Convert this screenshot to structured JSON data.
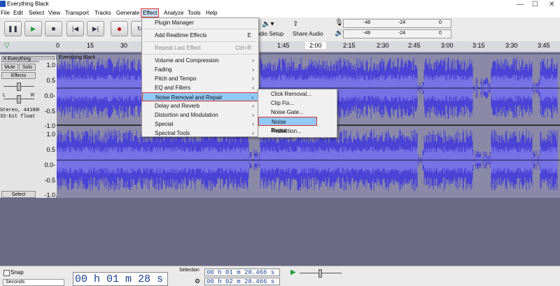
{
  "window": {
    "title": "Everything Black",
    "min": "—",
    "max": "☐",
    "close": "✕"
  },
  "menubar": [
    {
      "label": "File"
    },
    {
      "label": "Edit"
    },
    {
      "label": "Select"
    },
    {
      "label": "View"
    },
    {
      "label": "Transport"
    },
    {
      "label": "Tracks"
    },
    {
      "label": "Generate"
    },
    {
      "label": "Effect"
    },
    {
      "label": "Analyze"
    },
    {
      "label": "Tools"
    },
    {
      "label": "Help"
    }
  ],
  "toolbar": {
    "audio_setup": "udio Setup",
    "share_audio": "Share Audio",
    "meter_top": {
      "a": "-48",
      "b": "-24",
      "c": "0"
    },
    "meter_bottom": {
      "a": "-48",
      "b": "-24",
      "c": "0"
    }
  },
  "ruler": {
    "ticks": [
      "0",
      "15",
      "30",
      "1:45",
      "2:00",
      "2:15",
      "2:30",
      "2:45",
      "3:00",
      "3:15",
      "3:30",
      "3:45"
    ]
  },
  "track": {
    "name": "Everything",
    "mute": "Mute",
    "solo": "Solo",
    "effects": "Effects",
    "left": "L",
    "right": "R",
    "info_line1": "Stereo, 44100Hz",
    "info_line2": "32-bit float",
    "select": "Select",
    "clip_title": "Everything Black",
    "scale_top": [
      "1.0",
      "0.5",
      "0.0-",
      "-0.5",
      "-1.0"
    ],
    "scale_bottom": [
      "1.0",
      "0.5",
      "0.0-",
      "-0.5",
      "-1.0"
    ]
  },
  "effect_menu": {
    "items": [
      {
        "label": "Plugin Manager",
        "shortcut": "",
        "arrow": false,
        "disabled": false
      },
      {
        "sep": true
      },
      {
        "label": "Add Realtime Effects",
        "shortcut": "E",
        "arrow": false,
        "disabled": false
      },
      {
        "sep": true
      },
      {
        "label": "Repeat Last Effect",
        "shortcut": "Ctrl+R",
        "arrow": false,
        "disabled": true
      },
      {
        "sep": true
      },
      {
        "label": "Volume and Compression",
        "shortcut": "",
        "arrow": true,
        "disabled": false
      },
      {
        "label": "Fading",
        "shortcut": "",
        "arrow": true,
        "disabled": false
      },
      {
        "label": "Pitch and Tempo",
        "shortcut": "",
        "arrow": true,
        "disabled": false
      },
      {
        "label": "EQ and Filters",
        "shortcut": "",
        "arrow": true,
        "disabled": false
      },
      {
        "label": "Noise Removal and Repair",
        "shortcut": "",
        "arrow": true,
        "disabled": false,
        "highlight": true
      },
      {
        "label": "Delay and Reverb",
        "shortcut": "",
        "arrow": true,
        "disabled": false
      },
      {
        "label": "Distortion and Modulation",
        "shortcut": "",
        "arrow": true,
        "disabled": false
      },
      {
        "label": "Special",
        "shortcut": "",
        "arrow": true,
        "disabled": false
      },
      {
        "label": "Spectral Tools",
        "shortcut": "",
        "arrow": true,
        "disabled": false
      }
    ]
  },
  "submenu": {
    "items": [
      {
        "label": "Click Removal..."
      },
      {
        "label": "Clip Fix..."
      },
      {
        "label": "Noise Gate..."
      },
      {
        "label": "Noise Reduction...",
        "highlight": true
      },
      {
        "label": "Repair"
      }
    ]
  },
  "status": {
    "snap": "Snap",
    "seconds": "Seconds",
    "time": "00 h 01 m 28 s",
    "selection_label": "Selection",
    "sel_start": "00 h 01 m 28.466 s",
    "sel_end": "00 h 02 m 28.466 s"
  },
  "colors": {
    "wave": "#4a43d6",
    "wave_light": "#8a86ec",
    "accent_red": "#e0312e",
    "hover": "#91c9f7"
  }
}
